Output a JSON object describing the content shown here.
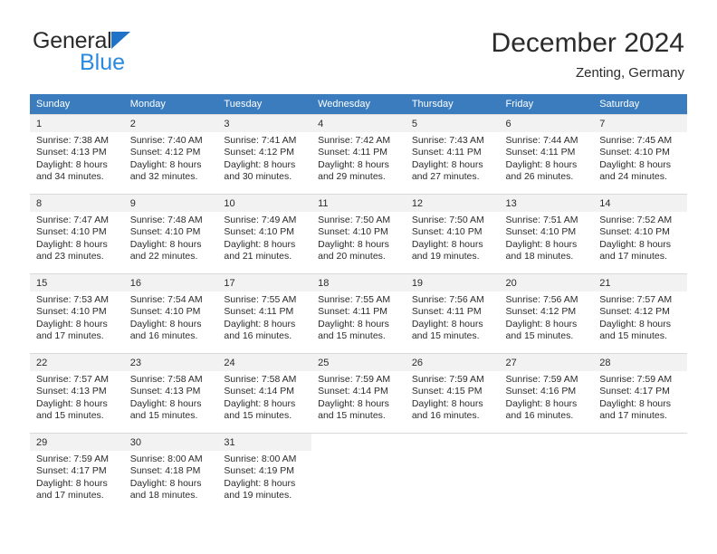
{
  "brand": {
    "name_part1": "General",
    "name_part2": "Blue",
    "triangle_icon": "blue-triangle-icon",
    "colors": {
      "dark": "#2b2b2b",
      "blue": "#2a8ae0",
      "triangle": "#1e73c8"
    }
  },
  "header": {
    "title": "December 2024",
    "subtitle": "Zenting, Germany"
  },
  "calendar": {
    "accent_color": "#3a7cbe",
    "weekday_headers": [
      "Sunday",
      "Monday",
      "Tuesday",
      "Wednesday",
      "Thursday",
      "Friday",
      "Saturday"
    ],
    "weeks": [
      [
        {
          "day": "1",
          "sunrise": "Sunrise: 7:38 AM",
          "sunset": "Sunset: 4:13 PM",
          "daylight1": "Daylight: 8 hours",
          "daylight2": "and 34 minutes."
        },
        {
          "day": "2",
          "sunrise": "Sunrise: 7:40 AM",
          "sunset": "Sunset: 4:12 PM",
          "daylight1": "Daylight: 8 hours",
          "daylight2": "and 32 minutes."
        },
        {
          "day": "3",
          "sunrise": "Sunrise: 7:41 AM",
          "sunset": "Sunset: 4:12 PM",
          "daylight1": "Daylight: 8 hours",
          "daylight2": "and 30 minutes."
        },
        {
          "day": "4",
          "sunrise": "Sunrise: 7:42 AM",
          "sunset": "Sunset: 4:11 PM",
          "daylight1": "Daylight: 8 hours",
          "daylight2": "and 29 minutes."
        },
        {
          "day": "5",
          "sunrise": "Sunrise: 7:43 AM",
          "sunset": "Sunset: 4:11 PM",
          "daylight1": "Daylight: 8 hours",
          "daylight2": "and 27 minutes."
        },
        {
          "day": "6",
          "sunrise": "Sunrise: 7:44 AM",
          "sunset": "Sunset: 4:11 PM",
          "daylight1": "Daylight: 8 hours",
          "daylight2": "and 26 minutes."
        },
        {
          "day": "7",
          "sunrise": "Sunrise: 7:45 AM",
          "sunset": "Sunset: 4:10 PM",
          "daylight1": "Daylight: 8 hours",
          "daylight2": "and 24 minutes."
        }
      ],
      [
        {
          "day": "8",
          "sunrise": "Sunrise: 7:47 AM",
          "sunset": "Sunset: 4:10 PM",
          "daylight1": "Daylight: 8 hours",
          "daylight2": "and 23 minutes."
        },
        {
          "day": "9",
          "sunrise": "Sunrise: 7:48 AM",
          "sunset": "Sunset: 4:10 PM",
          "daylight1": "Daylight: 8 hours",
          "daylight2": "and 22 minutes."
        },
        {
          "day": "10",
          "sunrise": "Sunrise: 7:49 AM",
          "sunset": "Sunset: 4:10 PM",
          "daylight1": "Daylight: 8 hours",
          "daylight2": "and 21 minutes."
        },
        {
          "day": "11",
          "sunrise": "Sunrise: 7:50 AM",
          "sunset": "Sunset: 4:10 PM",
          "daylight1": "Daylight: 8 hours",
          "daylight2": "and 20 minutes."
        },
        {
          "day": "12",
          "sunrise": "Sunrise: 7:50 AM",
          "sunset": "Sunset: 4:10 PM",
          "daylight1": "Daylight: 8 hours",
          "daylight2": "and 19 minutes."
        },
        {
          "day": "13",
          "sunrise": "Sunrise: 7:51 AM",
          "sunset": "Sunset: 4:10 PM",
          "daylight1": "Daylight: 8 hours",
          "daylight2": "and 18 minutes."
        },
        {
          "day": "14",
          "sunrise": "Sunrise: 7:52 AM",
          "sunset": "Sunset: 4:10 PM",
          "daylight1": "Daylight: 8 hours",
          "daylight2": "and 17 minutes."
        }
      ],
      [
        {
          "day": "15",
          "sunrise": "Sunrise: 7:53 AM",
          "sunset": "Sunset: 4:10 PM",
          "daylight1": "Daylight: 8 hours",
          "daylight2": "and 17 minutes."
        },
        {
          "day": "16",
          "sunrise": "Sunrise: 7:54 AM",
          "sunset": "Sunset: 4:10 PM",
          "daylight1": "Daylight: 8 hours",
          "daylight2": "and 16 minutes."
        },
        {
          "day": "17",
          "sunrise": "Sunrise: 7:55 AM",
          "sunset": "Sunset: 4:11 PM",
          "daylight1": "Daylight: 8 hours",
          "daylight2": "and 16 minutes."
        },
        {
          "day": "18",
          "sunrise": "Sunrise: 7:55 AM",
          "sunset": "Sunset: 4:11 PM",
          "daylight1": "Daylight: 8 hours",
          "daylight2": "and 15 minutes."
        },
        {
          "day": "19",
          "sunrise": "Sunrise: 7:56 AM",
          "sunset": "Sunset: 4:11 PM",
          "daylight1": "Daylight: 8 hours",
          "daylight2": "and 15 minutes."
        },
        {
          "day": "20",
          "sunrise": "Sunrise: 7:56 AM",
          "sunset": "Sunset: 4:12 PM",
          "daylight1": "Daylight: 8 hours",
          "daylight2": "and 15 minutes."
        },
        {
          "day": "21",
          "sunrise": "Sunrise: 7:57 AM",
          "sunset": "Sunset: 4:12 PM",
          "daylight1": "Daylight: 8 hours",
          "daylight2": "and 15 minutes."
        }
      ],
      [
        {
          "day": "22",
          "sunrise": "Sunrise: 7:57 AM",
          "sunset": "Sunset: 4:13 PM",
          "daylight1": "Daylight: 8 hours",
          "daylight2": "and 15 minutes."
        },
        {
          "day": "23",
          "sunrise": "Sunrise: 7:58 AM",
          "sunset": "Sunset: 4:13 PM",
          "daylight1": "Daylight: 8 hours",
          "daylight2": "and 15 minutes."
        },
        {
          "day": "24",
          "sunrise": "Sunrise: 7:58 AM",
          "sunset": "Sunset: 4:14 PM",
          "daylight1": "Daylight: 8 hours",
          "daylight2": "and 15 minutes."
        },
        {
          "day": "25",
          "sunrise": "Sunrise: 7:59 AM",
          "sunset": "Sunset: 4:14 PM",
          "daylight1": "Daylight: 8 hours",
          "daylight2": "and 15 minutes."
        },
        {
          "day": "26",
          "sunrise": "Sunrise: 7:59 AM",
          "sunset": "Sunset: 4:15 PM",
          "daylight1": "Daylight: 8 hours",
          "daylight2": "and 16 minutes."
        },
        {
          "day": "27",
          "sunrise": "Sunrise: 7:59 AM",
          "sunset": "Sunset: 4:16 PM",
          "daylight1": "Daylight: 8 hours",
          "daylight2": "and 16 minutes."
        },
        {
          "day": "28",
          "sunrise": "Sunrise: 7:59 AM",
          "sunset": "Sunset: 4:17 PM",
          "daylight1": "Daylight: 8 hours",
          "daylight2": "and 17 minutes."
        }
      ],
      [
        {
          "day": "29",
          "sunrise": "Sunrise: 7:59 AM",
          "sunset": "Sunset: 4:17 PM",
          "daylight1": "Daylight: 8 hours",
          "daylight2": "and 17 minutes."
        },
        {
          "day": "30",
          "sunrise": "Sunrise: 8:00 AM",
          "sunset": "Sunset: 4:18 PM",
          "daylight1": "Daylight: 8 hours",
          "daylight2": "and 18 minutes."
        },
        {
          "day": "31",
          "sunrise": "Sunrise: 8:00 AM",
          "sunset": "Sunset: 4:19 PM",
          "daylight1": "Daylight: 8 hours",
          "daylight2": "and 19 minutes."
        },
        {
          "day": "",
          "sunrise": "",
          "sunset": "",
          "daylight1": "",
          "daylight2": ""
        },
        {
          "day": "",
          "sunrise": "",
          "sunset": "",
          "daylight1": "",
          "daylight2": ""
        },
        {
          "day": "",
          "sunrise": "",
          "sunset": "",
          "daylight1": "",
          "daylight2": ""
        },
        {
          "day": "",
          "sunrise": "",
          "sunset": "",
          "daylight1": "",
          "daylight2": ""
        }
      ]
    ]
  }
}
